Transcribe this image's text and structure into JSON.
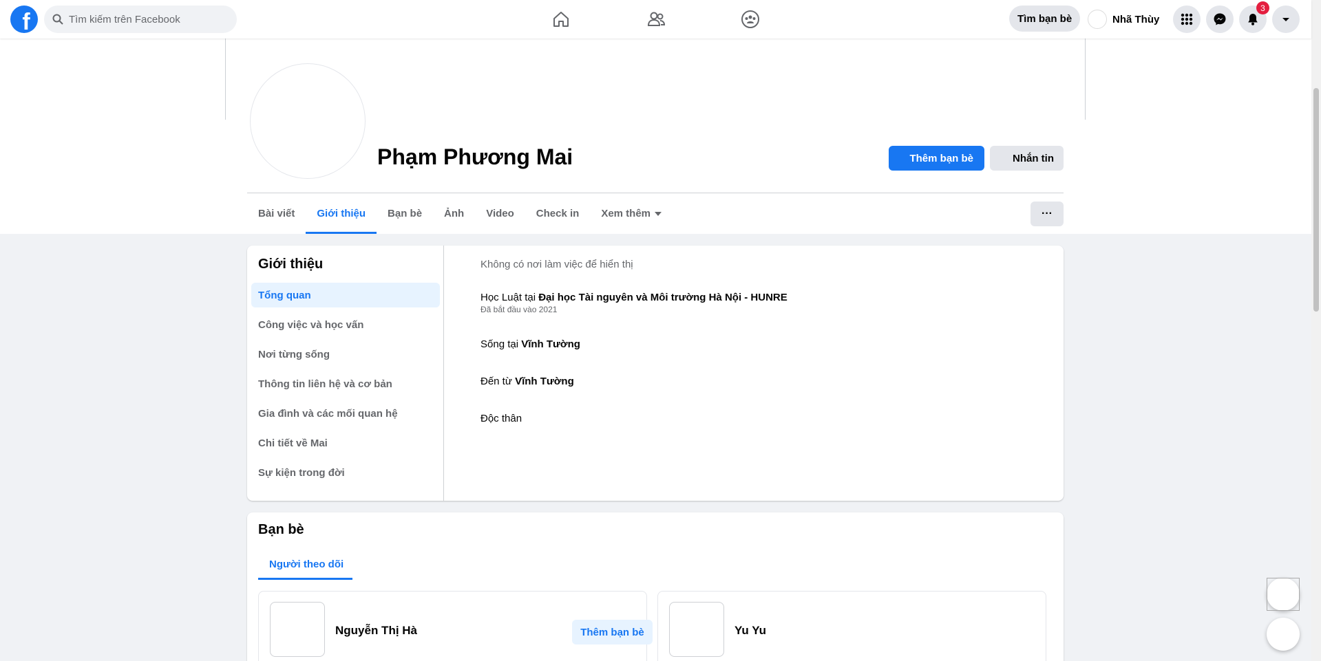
{
  "topbar": {
    "logo_letter": "f",
    "search_placeholder": "Tìm kiếm trên Facebook",
    "nav_icons": [
      "home-icon",
      "friends-icon",
      "groups-icon"
    ],
    "find_friends_label": "Tìm bạn bè",
    "user_name": "Nhã Thùy",
    "notification_count": "3",
    "right_icons": [
      "menu-grid-icon",
      "messenger-icon",
      "bell-icon",
      "account-caret-icon"
    ]
  },
  "profile": {
    "name": "Phạm Phương Mai",
    "add_friend_label": "Thêm bạn bè",
    "message_label": "Nhắn tin",
    "more_label": "···"
  },
  "tabs": [
    {
      "label": "Bài viết",
      "active": false
    },
    {
      "label": "Giới thiệu",
      "active": true
    },
    {
      "label": "Bạn bè",
      "active": false
    },
    {
      "label": "Ảnh",
      "active": false
    },
    {
      "label": "Video",
      "active": false
    },
    {
      "label": "Check in",
      "active": false
    },
    {
      "label": "Xem thêm",
      "active": false
    }
  ],
  "about": {
    "title": "Giới thiệu",
    "menu": [
      "Tổng quan",
      "Công việc và học vấn",
      "Nơi từng sống",
      "Thông tin liên hệ và cơ bản",
      "Gia đình và các mối quan hệ",
      "Chi tiết về Mai",
      "Sự kiện trong đời"
    ],
    "no_work": "Không có nơi làm việc để hiển thị",
    "study_prefix": "Học Luật tại ",
    "study_place": "Đại học Tài nguyên và Môi trường Hà Nội - HUNRE",
    "study_since": "Đã bắt đầu vào 2021",
    "lives_prefix": "Sống tại ",
    "lives_place": "Vĩnh Tường",
    "from_prefix": "Đến từ ",
    "from_place": "Vĩnh Tường",
    "relationship": "Độc thân"
  },
  "friends": {
    "title": "Bạn bè",
    "followers_tab": "Người theo dõi",
    "people": [
      {
        "name": "Nguyễn Thị Hà",
        "button": "Thêm bạn bè"
      },
      {
        "name": "Yu Yu",
        "button": ""
      }
    ]
  },
  "colors": {
    "accent": "#1877f2",
    "badge": "#e41e3f",
    "page_bg": "#f0f2f5"
  }
}
